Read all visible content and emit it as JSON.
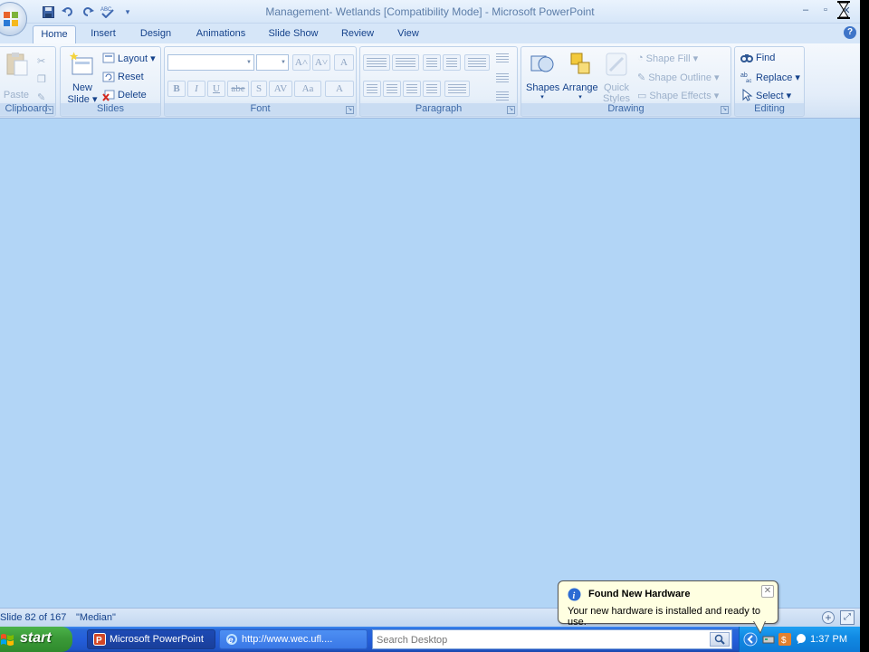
{
  "window": {
    "title": "Management- Wetlands [Compatibility Mode] - Microsoft PowerPoint",
    "minimize": "–",
    "restore": "▫",
    "close": "✕"
  },
  "tabs": [
    {
      "label": "Home",
      "active": true
    },
    {
      "label": "Insert"
    },
    {
      "label": "Design"
    },
    {
      "label": "Animations"
    },
    {
      "label": "Slide Show"
    },
    {
      "label": "Review"
    },
    {
      "label": "View"
    }
  ],
  "help": "?",
  "ribbon": {
    "clipboard": {
      "label": "Clipboard",
      "paste": "Paste"
    },
    "slides": {
      "label": "Slides",
      "new_slide_1": "New",
      "new_slide_2": "Slide ▾",
      "layout": "Layout ▾",
      "reset": "Reset",
      "delete": "Delete"
    },
    "font": {
      "label": "Font",
      "grow": "A˄",
      "shrink": "A˅",
      "clear": "A",
      "bold": "B",
      "italic": "I",
      "underline": "U",
      "strike": "abe",
      "shadow": "S",
      "spacing": "AV",
      "case": "Aa",
      "color": "A"
    },
    "paragraph": {
      "label": "Paragraph"
    },
    "drawing": {
      "label": "Drawing",
      "shapes": "Shapes",
      "arrange": "Arrange",
      "quick_styles_1": "Quick",
      "quick_styles_2": "Styles ▾",
      "shape_fill": "Shape Fill ▾",
      "shape_outline": "Shape Outline ▾",
      "shape_effects": "Shape Effects ▾"
    },
    "editing": {
      "label": "Editing",
      "find": "Find",
      "replace": "Replace ▾",
      "select": "Select ▾"
    }
  },
  "status": {
    "slide": "Slide 82 of 167",
    "theme": "\"Median\"",
    "zoom_in": "+",
    "fit": "⤢"
  },
  "taskbar": {
    "start": "start",
    "tasks": [
      {
        "label": "Microsoft PowerPoint",
        "active": true
      },
      {
        "label": "http://www.wec.ufl...."
      }
    ],
    "search_placeholder": "Search Desktop",
    "clock": "1:37 PM"
  },
  "balloon": {
    "title": "Found New Hardware",
    "message": "Your new hardware is installed and ready to use.",
    "close": "✕"
  },
  "colors": {
    "workspace": "#b2d5f6",
    "taskbar": "#245edb",
    "start": "#3b9a38",
    "balloon": "#ffffe1"
  },
  "icons": [
    "office-logo-icon",
    "save-icon",
    "undo-icon",
    "redo-icon",
    "spelling-icon",
    "paste-icon",
    "new-slide-icon",
    "find-icon",
    "search-icon",
    "info-icon",
    "windows-flag-icon",
    "ie-icon",
    "powerpoint-icon",
    "hourglass-icon"
  ]
}
